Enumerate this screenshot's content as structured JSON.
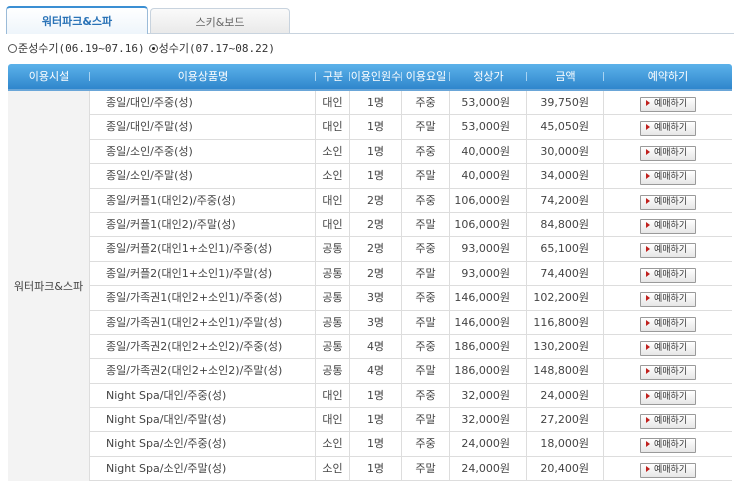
{
  "tabs": [
    {
      "label": "워터파크&스파",
      "active": true
    },
    {
      "label": "스키&보드",
      "active": false
    }
  ],
  "seasons": [
    {
      "label": "준성수기(06.19~07.16)",
      "selected": false
    },
    {
      "label": "성수기(07.17~08.22)",
      "selected": true
    }
  ],
  "table": {
    "headers": {
      "facility": "이용시설",
      "product": "이용상품명",
      "type": "구분",
      "people": "이용인원수",
      "day": "이용요일",
      "list_price": "정상가",
      "price": "금액",
      "reserve": "예약하기"
    },
    "facility": "워터파크&스파",
    "button_label": "예매하기",
    "rows": [
      {
        "product": "종일/대인/주중(성)",
        "type": "대인",
        "people": "1명",
        "day": "주중",
        "list_price": "53,000원",
        "price": "39,750원"
      },
      {
        "product": "종일/대인/주말(성)",
        "type": "대인",
        "people": "1명",
        "day": "주말",
        "list_price": "53,000원",
        "price": "45,050원"
      },
      {
        "product": "종일/소인/주중(성)",
        "type": "소인",
        "people": "1명",
        "day": "주중",
        "list_price": "40,000원",
        "price": "30,000원"
      },
      {
        "product": "종일/소인/주말(성)",
        "type": "소인",
        "people": "1명",
        "day": "주말",
        "list_price": "40,000원",
        "price": "34,000원"
      },
      {
        "product": "종일/커플1(대인2)/주중(성)",
        "type": "대인",
        "people": "2명",
        "day": "주중",
        "list_price": "106,000원",
        "price": "74,200원"
      },
      {
        "product": "종일/커플1(대인2)/주말(성)",
        "type": "대인",
        "people": "2명",
        "day": "주말",
        "list_price": "106,000원",
        "price": "84,800원"
      },
      {
        "product": "종일/커플2(대인1+소인1)/주중(성)",
        "type": "공통",
        "people": "2명",
        "day": "주중",
        "list_price": "93,000원",
        "price": "65,100원"
      },
      {
        "product": "종일/커플2(대인1+소인1)/주말(성)",
        "type": "공통",
        "people": "2명",
        "day": "주말",
        "list_price": "93,000원",
        "price": "74,400원"
      },
      {
        "product": "종일/가족권1(대인2+소인1)/주중(성)",
        "type": "공통",
        "people": "3명",
        "day": "주중",
        "list_price": "146,000원",
        "price": "102,200원"
      },
      {
        "product": "종일/가족권1(대인2+소인1)/주말(성)",
        "type": "공통",
        "people": "3명",
        "day": "주말",
        "list_price": "146,000원",
        "price": "116,800원"
      },
      {
        "product": "종일/가족권2(대인2+소인2)/주중(성)",
        "type": "공통",
        "people": "4명",
        "day": "주중",
        "list_price": "186,000원",
        "price": "130,200원"
      },
      {
        "product": "종일/가족권2(대인2+소인2)/주말(성)",
        "type": "공통",
        "people": "4명",
        "day": "주말",
        "list_price": "186,000원",
        "price": "148,800원"
      },
      {
        "product": "Night Spa/대인/주중(성)",
        "type": "대인",
        "people": "1명",
        "day": "주중",
        "list_price": "32,000원",
        "price": "24,000원"
      },
      {
        "product": "Night Spa/대인/주말(성)",
        "type": "대인",
        "people": "1명",
        "day": "주말",
        "list_price": "32,000원",
        "price": "27,200원"
      },
      {
        "product": "Night Spa/소인/주중(성)",
        "type": "소인",
        "people": "1명",
        "day": "주중",
        "list_price": "24,000원",
        "price": "18,000원"
      },
      {
        "product": "Night Spa/소인/주말(성)",
        "type": "소인",
        "people": "1명",
        "day": "주말",
        "list_price": "24,000원",
        "price": "20,400원"
      }
    ]
  },
  "colors": {
    "header_bar": "#2f86cc",
    "active_tab_text": "#2a73b7",
    "button_arrow": "#c0201d"
  }
}
